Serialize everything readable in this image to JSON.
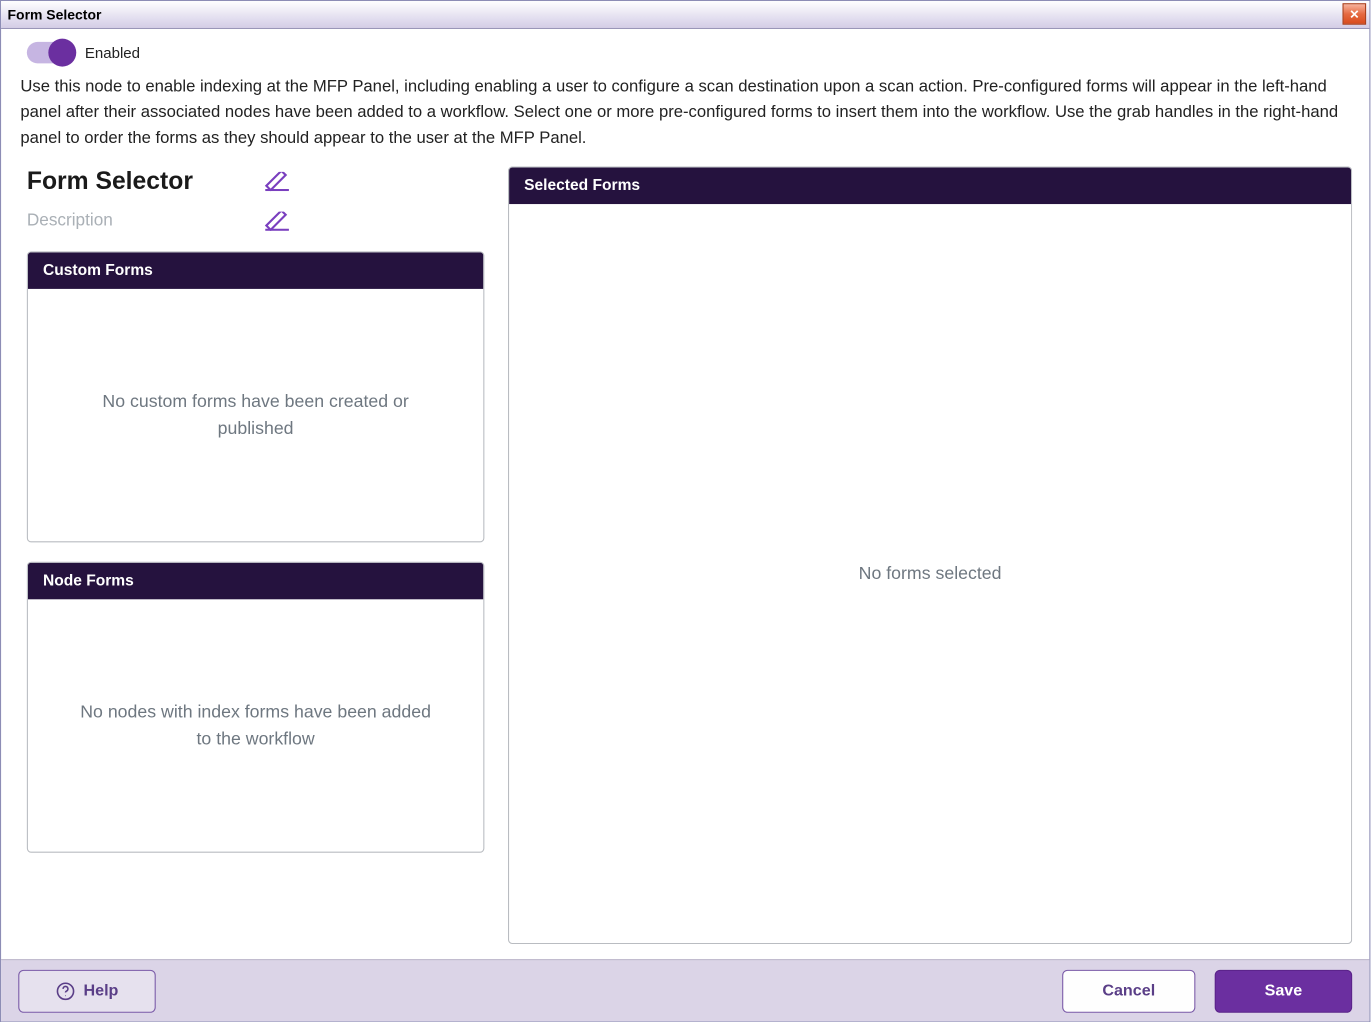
{
  "window": {
    "title": "Form Selector"
  },
  "toggle": {
    "label": "Enabled",
    "on": true
  },
  "intro": "Use this node to enable indexing at the MFP Panel, including enabling a user to configure a scan destination upon a scan action. Pre-configured forms will appear in the left-hand panel after their associated nodes have been added to a workflow. Select one or more pre-configured forms to insert them into the workflow. Use the grab handles in the right-hand panel to order the forms as they should appear to the user at the MFP Panel.",
  "editor": {
    "name": "Form Selector",
    "description_placeholder": "Description"
  },
  "panels": {
    "custom_forms": {
      "title": "Custom Forms",
      "empty": "No custom forms have been created or published"
    },
    "node_forms": {
      "title": "Node Forms",
      "empty": "No nodes with index forms have been added to the workflow"
    },
    "selected_forms": {
      "title": "Selected Forms",
      "empty": "No forms selected"
    }
  },
  "footer": {
    "help": "Help",
    "cancel": "Cancel",
    "save": "Save"
  },
  "colors": {
    "accent": "#6b2fa0",
    "panel_header": "#25123e",
    "footer_bg": "#dbd4e7"
  }
}
